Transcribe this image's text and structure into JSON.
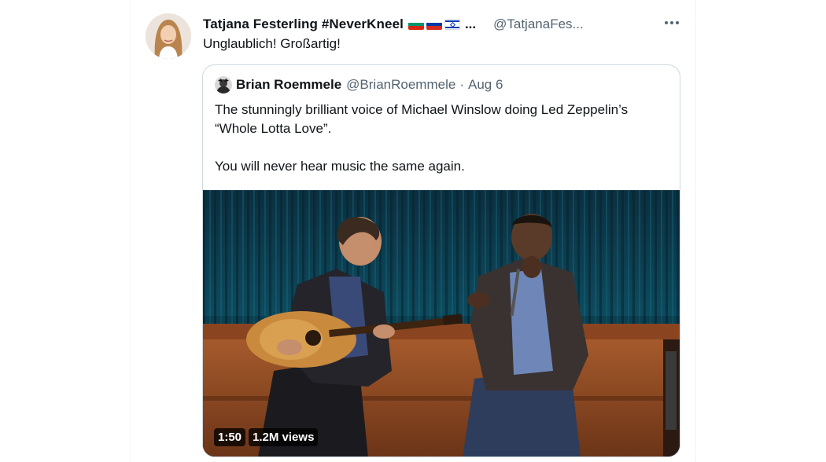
{
  "tweet": {
    "display_name": "Tatjana Festerling #NeverKneel",
    "name_truncation": "...",
    "handle": "@TatjanaFes...",
    "text": "Unglaublich! Großartig!",
    "flags": [
      "flag-bulgaria-icon",
      "flag-russia-icon",
      "flag-israel-icon"
    ],
    "more_icon": "more-horizontal-icon"
  },
  "quote": {
    "display_name": "Brian Roemmele",
    "handle": "@BrianRoemmele",
    "separator": "·",
    "date": "Aug 6",
    "lines": [
      "The stunningly brilliant voice of Michael Winslow doing Led Zeppelin’s",
      "“Whole Lotta Love”.",
      "",
      "You will never hear music the same again."
    ],
    "video": {
      "duration": "1:50",
      "views": "1.2M views"
    }
  },
  "colors": {
    "text_primary": "#0f1419",
    "text_secondary": "#536471",
    "border": "#cfd9de"
  }
}
